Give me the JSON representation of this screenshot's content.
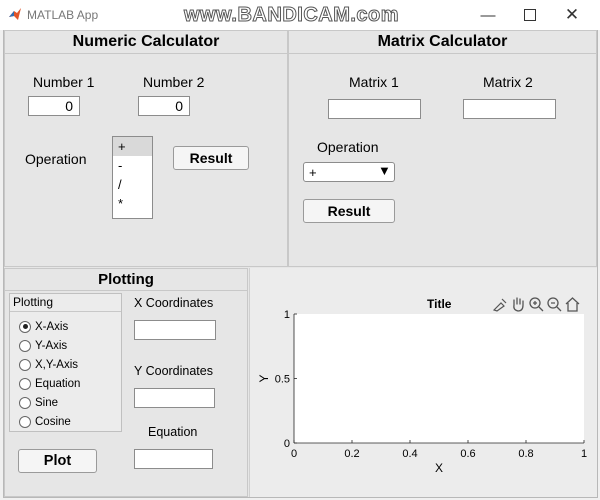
{
  "window": {
    "title": "MATLAB App",
    "watermark": "www.BANDICAM.com",
    "controls": [
      "minimize-icon",
      "maximize-icon",
      "close-icon"
    ]
  },
  "numeric": {
    "title": "Numeric Calculator",
    "number1_label": "Number 1",
    "number1_value": "0",
    "number2_label": "Number 2",
    "number2_value": "0",
    "operation_label": "Operation",
    "operations": [
      "+",
      "-",
      "/",
      "*"
    ],
    "selected_operation": "+",
    "result_button": "Result"
  },
  "matrix": {
    "title": "Matrix Calculator",
    "matrix1_label": "Matrix 1",
    "matrix1_value": "",
    "matrix2_label": "Matrix 2",
    "matrix2_value": "",
    "operation_label": "Operation",
    "operation_value": "+",
    "result_button": "Result"
  },
  "plotting": {
    "title": "Plotting",
    "group_title": "Plotting",
    "options": [
      "X-Axis",
      "Y-Axis",
      "X,Y-Axis",
      "Equation",
      "Sine",
      "Cosine"
    ],
    "selected_option": "X-Axis",
    "x_label": "X Coordinates",
    "x_value": "",
    "y_label": "Y Coordinates",
    "y_value": "",
    "equation_label": "Equation",
    "equation_value": "",
    "plot_button": "Plot"
  },
  "axes": {
    "title": "Title",
    "xlabel": "X",
    "ylabel": "Y",
    "xlim": [
      0,
      1
    ],
    "ylim": [
      0,
      1
    ],
    "xticks": [
      "0",
      "0.2",
      "0.4",
      "0.6",
      "0.8",
      "1"
    ],
    "yticks": [
      "0",
      "0.5",
      "1"
    ],
    "toolbar_icons": [
      "brush-icon",
      "pan-hand-icon",
      "zoom-in-icon",
      "zoom-out-icon",
      "home-icon"
    ]
  }
}
